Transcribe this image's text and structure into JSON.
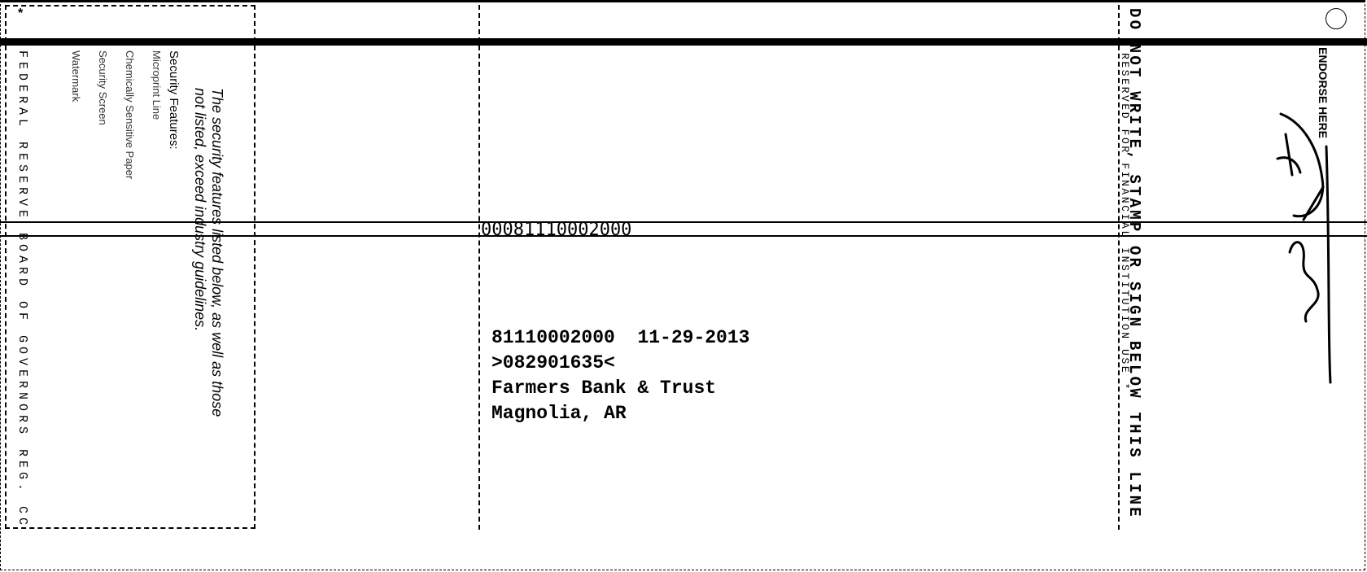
{
  "left_panel": {
    "security_note_line1": "The security features listed below, as well as those",
    "security_note_line2": "not listed, exceed industry guidelines.",
    "features_heading": "Security Features:",
    "features": [
      "Microprint Line",
      "Chemically Sensitive Paper",
      "Security Screen",
      "Watermark"
    ],
    "regulation_text": "FEDERAL RESERVE BOARD OF GOVERNORS REG. CC",
    "asterisk": "*"
  },
  "center": {
    "sequence_number": "00081110002000",
    "item_number": "81110002000",
    "date": "11-29-2013",
    "routing_number": ">082901635<",
    "bank_name": "Farmers Bank & Trust",
    "bank_location": "Magnolia, AR"
  },
  "right_panel": {
    "warning": "DO NOT WRITE, STAMP OR SIGN BELOW THIS LINE",
    "reserved": "RESERVED FOR FINANCIAL INSTITUTION USE *",
    "endorse_label": "ENDORSE HERE"
  }
}
